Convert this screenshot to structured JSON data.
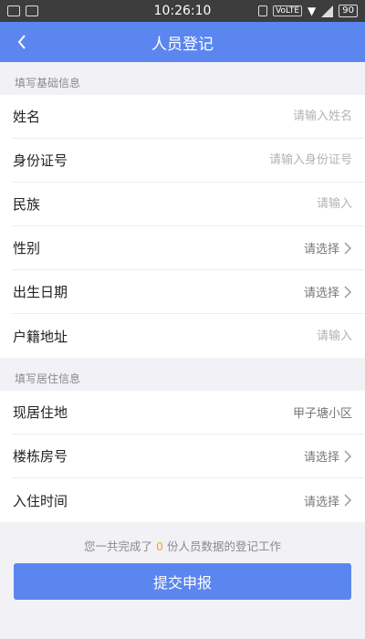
{
  "status_bar": {
    "time": "10:26:10",
    "network": "VoLTE",
    "battery": "90"
  },
  "header": {
    "title": "人员登记"
  },
  "basic_section": {
    "label": "填写基础信息",
    "name": {
      "label": "姓名",
      "placeholder": "请输入姓名"
    },
    "id_number": {
      "label": "身份证号",
      "placeholder": "请输入身份证号"
    },
    "ethnicity": {
      "label": "民族",
      "placeholder": "请输入"
    },
    "gender": {
      "label": "性别",
      "select_text": "请选择"
    },
    "birth_date": {
      "label": "出生日期",
      "select_text": "请选择"
    },
    "household_address": {
      "label": "户籍地址",
      "placeholder": "请输入"
    }
  },
  "residence_section": {
    "label": "填写居住信息",
    "current_residence": {
      "label": "现居住地",
      "value": "甲子塘小区"
    },
    "building_room": {
      "label": "楼栋房号",
      "select_text": "请选择"
    },
    "move_in_time": {
      "label": "入住时间",
      "select_text": "请选择"
    }
  },
  "summary": {
    "prefix": "您一共完成了",
    "count": "0",
    "suffix": "份人员数据的登记工作"
  },
  "submit": {
    "label": "提交申报"
  },
  "colors": {
    "primary": "#5b86f0",
    "count_highlight": "#f5a623"
  }
}
